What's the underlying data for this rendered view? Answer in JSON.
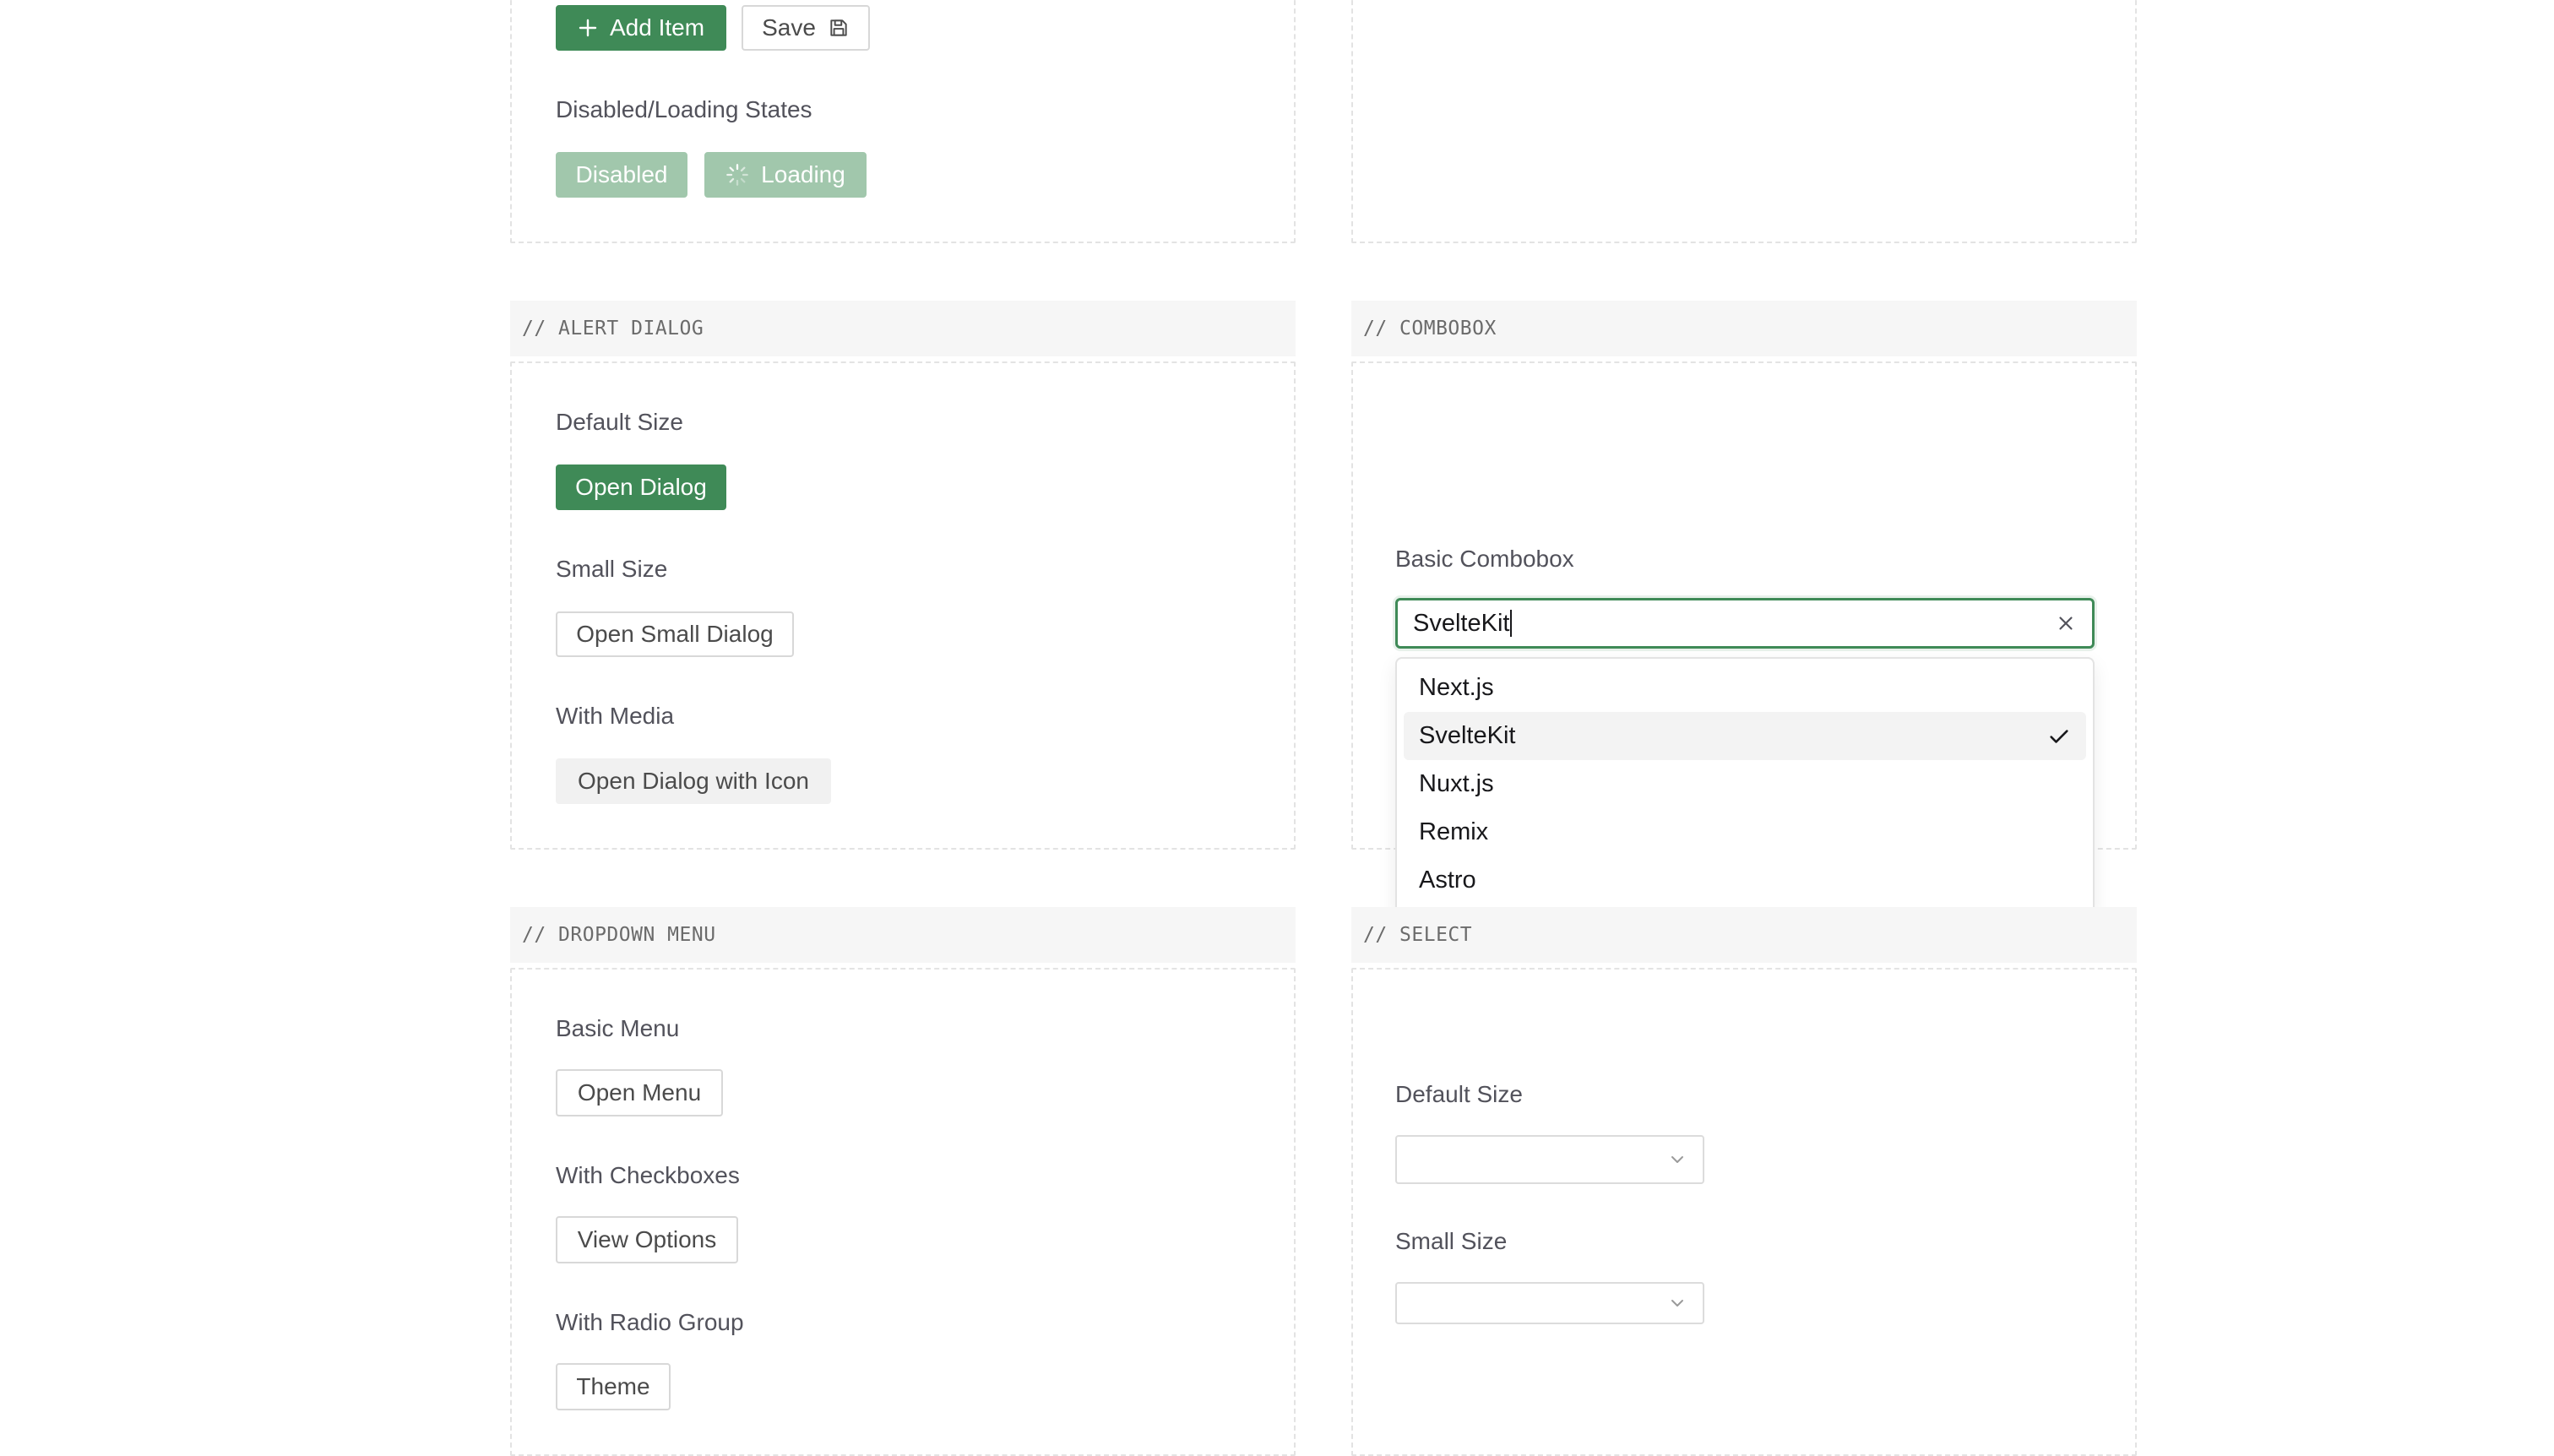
{
  "buttons_section": {
    "add_item_label": "Add Item",
    "save_label": "Save",
    "disabled_loading_label": "Disabled/Loading States",
    "disabled_label": "Disabled",
    "loading_label": "Loading"
  },
  "alert_dialog": {
    "header": "// ALERT DIALOG",
    "default_size_label": "Default Size",
    "open_dialog": "Open Dialog",
    "small_size_label": "Small Size",
    "open_small_dialog": "Open Small Dialog",
    "with_media_label": "With Media",
    "open_dialog_with_icon": "Open Dialog with Icon"
  },
  "combobox": {
    "header": "// COMBOBOX",
    "label": "Basic Combobox",
    "input_value": "SvelteKit",
    "options": [
      {
        "label": "Next.js",
        "selected": false
      },
      {
        "label": "SvelteKit",
        "selected": true
      },
      {
        "label": "Nuxt.js",
        "selected": false
      },
      {
        "label": "Remix",
        "selected": false
      },
      {
        "label": "Astro",
        "selected": false
      }
    ]
  },
  "dropdown_menu": {
    "header": "// DROPDOWN MENU",
    "basic_menu_label": "Basic Menu",
    "open_menu": "Open Menu",
    "with_checkboxes_label": "With Checkboxes",
    "view_options": "View Options",
    "with_radio_group_label": "With Radio Group",
    "theme": "Theme"
  },
  "select": {
    "header": "// SELECT",
    "default_size_label": "Default Size",
    "small_size_label": "Small Size",
    "default_value": "",
    "small_value": ""
  },
  "colors": {
    "primary": "#3f8a57",
    "disabled": "#a1c7ac",
    "border_dashed": "#e3e3e3"
  }
}
